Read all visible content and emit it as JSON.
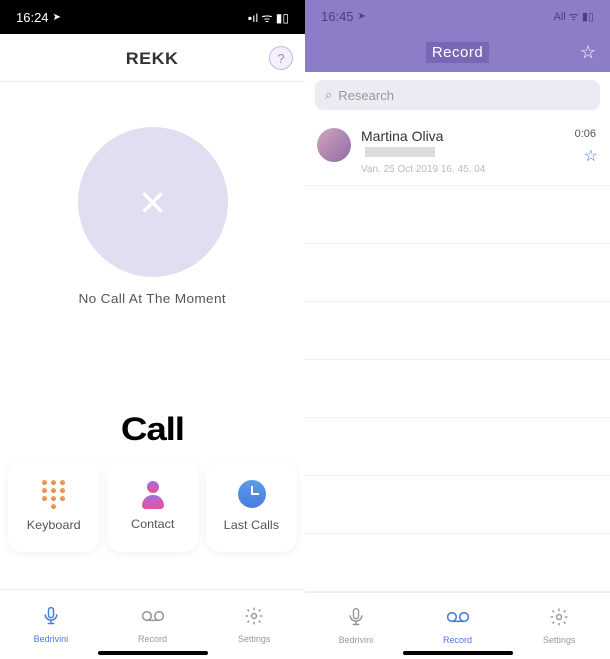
{
  "left": {
    "status": {
      "time": "16:24",
      "location_icon": "➤",
      "indicators": "▪ıl ᯤ ▮▯"
    },
    "header": {
      "title": "REKK",
      "help_label": "?"
    },
    "no_call": {
      "icon": "×",
      "text": "No Call At The Moment"
    },
    "section_title": "Call",
    "cards": [
      {
        "name": "keyboard-card",
        "label": "Keyboard"
      },
      {
        "name": "contact-card",
        "label": "Contact"
      },
      {
        "name": "lastcalls-card",
        "label": "Last Calls"
      }
    ],
    "tabs": [
      {
        "name": "tab-record-audio",
        "label": "Bedrivini",
        "active": true
      },
      {
        "name": "tab-recordings",
        "label": "Record",
        "active": false
      },
      {
        "name": "tab-settings",
        "label": "Settings",
        "active": false
      }
    ]
  },
  "right": {
    "status": {
      "time": "16:45",
      "location_icon": "➤",
      "indicators": "All ᯤ ▮▯"
    },
    "header": {
      "title": "Record",
      "star": "☆"
    },
    "search": {
      "icon": "⌕",
      "placeholder": "Research"
    },
    "recordings": [
      {
        "name": "Martina Oliva",
        "date": "Van. 25 Oct 2019 16. 45. 04",
        "duration": "0:06",
        "starred": true
      }
    ],
    "tabs": [
      {
        "name": "tab-record-audio",
        "label": "Bedrivini",
        "active": false
      },
      {
        "name": "tab-recordings",
        "label": "Record",
        "active": true
      },
      {
        "name": "tab-settings",
        "label": "Settings",
        "active": false
      }
    ]
  }
}
